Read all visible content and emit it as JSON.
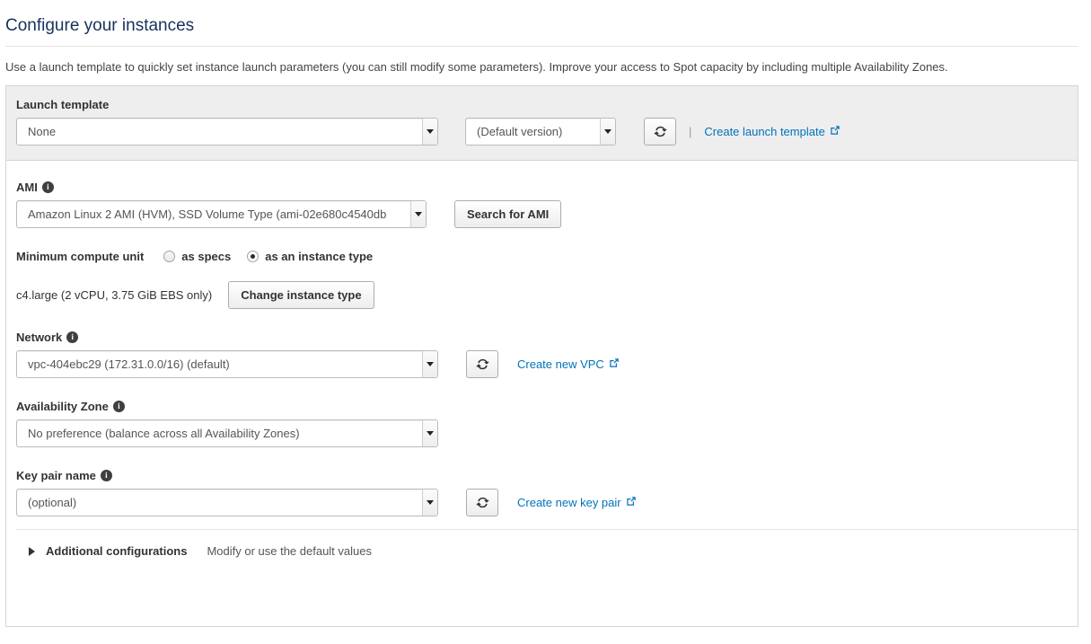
{
  "page": {
    "title": "Configure your instances",
    "description": "Use a launch template to quickly set instance launch parameters (you can still modify some parameters). Improve your access to Spot capacity by including multiple Availability Zones."
  },
  "launch_template": {
    "label": "Launch template",
    "template_value": "None",
    "version_value": "(Default version)",
    "refresh_icon": "refresh-icon",
    "separator": "|",
    "create_link": "Create launch template",
    "external_icon": "external-link-icon"
  },
  "ami": {
    "label": "AMI",
    "info_icon": "info-icon",
    "value": "Amazon Linux 2 AMI (HVM), SSD Volume Type (ami-02e680c4540db",
    "search_button": "Search for AMI"
  },
  "compute_unit": {
    "label": "Minimum compute unit",
    "options": [
      {
        "label": "as specs",
        "selected": false
      },
      {
        "label": "as an instance type",
        "selected": true
      }
    ],
    "instance_summary": "c4.large (2 vCPU, 3.75 GiB EBS only)",
    "change_button": "Change instance type"
  },
  "network": {
    "label": "Network",
    "info_icon": "info-icon",
    "value": "vpc-404ebc29 (172.31.0.0/16) (default)",
    "refresh_icon": "refresh-icon",
    "create_link": "Create new VPC",
    "external_icon": "external-link-icon"
  },
  "availability_zone": {
    "label": "Availability Zone",
    "info_icon": "info-icon",
    "value": "No preference (balance across all Availability Zones)"
  },
  "key_pair": {
    "label": "Key pair name",
    "info_icon": "info-icon",
    "value": "(optional)",
    "refresh_icon": "refresh-icon",
    "create_link": "Create new key pair",
    "external_icon": "external-link-icon"
  },
  "additional": {
    "expand_icon": "expand-triangle-icon",
    "title": "Additional configurations",
    "subtitle": "Modify or use the default values"
  },
  "colors": {
    "title": "#16325c",
    "link": "#0073bb",
    "panel_head_bg": "#eeeeee",
    "border": "#d5d5d5"
  }
}
